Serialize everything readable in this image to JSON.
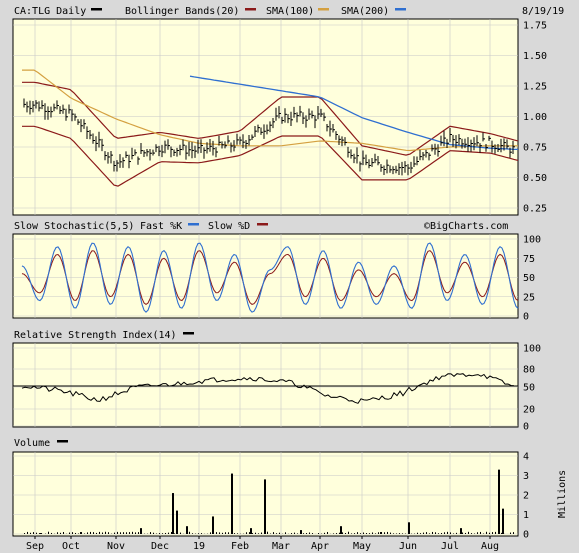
{
  "header": {
    "symbol": "CA:TLG Daily",
    "indicators": [
      {
        "label": "Bollinger Bands(20)",
        "color": "#8b1a1a"
      },
      {
        "label": "SMA(100)",
        "color": "#8b1a1a"
      },
      {
        "label": "SMA(200)",
        "color": "#1565c0"
      }
    ],
    "symbol_color": "#000000",
    "date": "8/19/19"
  },
  "watermark": "©BigCharts.com",
  "colors": {
    "price": "#000000",
    "bollinger": "#8b1a1a",
    "sma100": "#d4a040",
    "sma200": "#2f6fd0",
    "fast_k": "#2f6fd0",
    "slow_d": "#8b1a1a",
    "rsi": "#000000",
    "volume": "#000000",
    "background": "#d9d9d9",
    "plot_bg": "#ffffdc"
  },
  "panels": {
    "price": {
      "ticks": [
        "1.75",
        "1.50",
        "1.25",
        "1.00",
        "0.75",
        "0.50",
        "0.25"
      ]
    },
    "stochastic": {
      "title": "Slow Stochastic(5,5)",
      "fast_label": "Fast %K",
      "slow_label": "Slow %D",
      "ticks": [
        "100",
        "75",
        "50",
        "25",
        "0"
      ]
    },
    "rsi": {
      "title": "Relative Strength Index(14)",
      "ticks": [
        "100",
        "80",
        "50",
        "20",
        "0"
      ]
    },
    "volume": {
      "title": "Volume",
      "ticks": [
        "4",
        "3",
        "2",
        "1",
        "0"
      ],
      "unit": "Millions"
    }
  },
  "x_axis": [
    "Sep",
    "Oct",
    "Nov",
    "Dec",
    "19",
    "Feb",
    "Mar",
    "Apr",
    "May",
    "Jun",
    "Jul",
    "Aug"
  ],
  "chart_data": [
    {
      "type": "line",
      "title": "CA:TLG Daily",
      "ylim": [
        0.25,
        1.75
      ],
      "x": [
        "Sep",
        "Oct",
        "Nov",
        "Dec",
        "19",
        "Feb",
        "Mar",
        "Apr",
        "May",
        "Jun",
        "Jul",
        "Aug"
      ],
      "series": [
        {
          "name": "CA:TLG Daily",
          "values": [
            1.1,
            1.02,
            0.62,
            0.75,
            0.72,
            0.78,
            1.0,
            1.0,
            0.62,
            0.58,
            0.82,
            0.78
          ]
        },
        {
          "name": "SMA(100)",
          "values": [
            1.38,
            1.15,
            0.98,
            0.85,
            0.78,
            0.76,
            0.76,
            0.8,
            0.78,
            0.72,
            0.75,
            0.76
          ]
        },
        {
          "name": "SMA(200)",
          "values": [
            null,
            null,
            null,
            null,
            null,
            null,
            1.33,
            1.16,
            0.99,
            0.87,
            0.77,
            0.74
          ]
        }
      ]
    },
    {
      "type": "line",
      "title": "Slow Stochastic(5,5)",
      "ylim": [
        0,
        100
      ],
      "series": [
        {
          "name": "Fast %K",
          "values": [
            65,
            20,
            90,
            10,
            95,
            15,
            90,
            5,
            85,
            10,
            95,
            20,
            80,
            5,
            60,
            90,
            15,
            85,
            10,
            70,
            15,
            65,
            10,
            95,
            20,
            80,
            15,
            90,
            10
          ]
        },
        {
          "name": "Slow %D",
          "values": [
            55,
            30,
            80,
            20,
            85,
            25,
            80,
            15,
            75,
            20,
            85,
            30,
            70,
            15,
            55,
            80,
            25,
            75,
            20,
            60,
            25,
            55,
            20,
            85,
            30,
            70,
            25,
            80,
            20
          ]
        }
      ]
    },
    {
      "type": "line",
      "title": "Relative Strength Index(14)",
      "ylim": [
        0,
        100
      ],
      "series": [
        {
          "name": "RSI",
          "values": [
            52,
            45,
            32,
            50,
            55,
            62,
            65,
            58,
            38,
            30,
            42,
            68,
            72,
            48
          ]
        }
      ]
    },
    {
      "type": "bar",
      "title": "Volume",
      "ylabel": "Millions",
      "ylim": [
        0,
        4
      ],
      "values": [
        0.05,
        0.1,
        0.3,
        2.1,
        1.2,
        0.4,
        0.9,
        3.1,
        0.3,
        2.8,
        0.2,
        0.4,
        0.1,
        0.6,
        0.3,
        3.3,
        1.3
      ]
    }
  ]
}
